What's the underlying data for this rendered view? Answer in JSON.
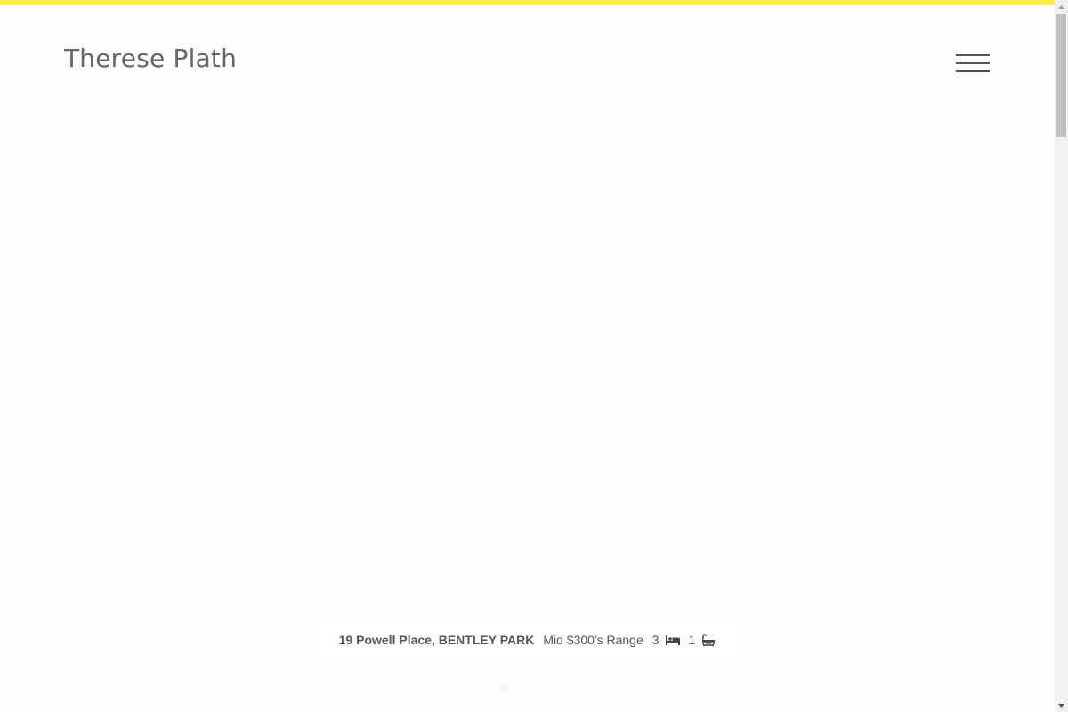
{
  "site": {
    "title": "Therese Plath",
    "accent_color": "#ffeb3b"
  },
  "header": {
    "menu_icon": "hamburger-menu-icon"
  },
  "listing": {
    "address": "19 Powell Place, BENTLEY PARK",
    "price": "Mid $300's Range",
    "bedrooms": "3",
    "bedroom_icon": "bed-icon",
    "bathrooms": "1",
    "bathroom_icon": "bath-icon"
  }
}
